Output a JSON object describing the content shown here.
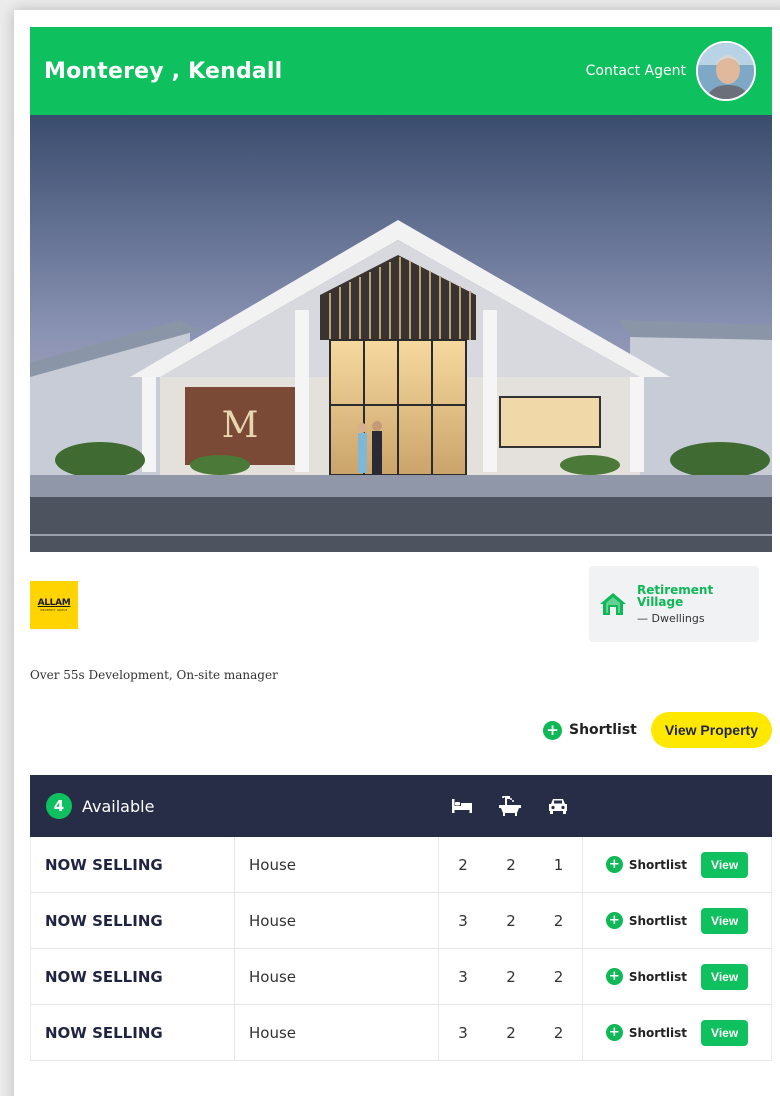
{
  "header": {
    "title": "Monterey , Kendall",
    "contact_label": "Contact Agent"
  },
  "developer": {
    "logo_text": "ALLAM",
    "logo_subtext": "PROPERTY GROUP"
  },
  "project_type": {
    "name": "Retirement Village",
    "dwellings": "— Dwellings",
    "icon": "house-icon"
  },
  "description": "Over 55s Development, On-site manager",
  "actions": {
    "shortlist_label": "Shortlist",
    "view_property_label": "View Property"
  },
  "availability": {
    "count": "4",
    "label": "Available",
    "header_icons": [
      "bed-icon",
      "bath-icon",
      "car-icon"
    ],
    "rows": [
      {
        "status": "NOW SELLING",
        "type": "House",
        "beds": "2",
        "baths": "2",
        "cars": "1",
        "shortlist": "Shortlist",
        "view": "View"
      },
      {
        "status": "NOW SELLING",
        "type": "House",
        "beds": "3",
        "baths": "2",
        "cars": "2",
        "shortlist": "Shortlist",
        "view": "View"
      },
      {
        "status": "NOW SELLING",
        "type": "House",
        "beds": "3",
        "baths": "2",
        "cars": "2",
        "shortlist": "Shortlist",
        "view": "View"
      },
      {
        "status": "NOW SELLING",
        "type": "House",
        "beds": "3",
        "baths": "2",
        "cars": "2",
        "shortlist": "Shortlist",
        "view": "View"
      }
    ]
  },
  "colors": {
    "brand_green": "#0fc15e",
    "navy": "#272d47",
    "yellow": "#ffe800"
  }
}
